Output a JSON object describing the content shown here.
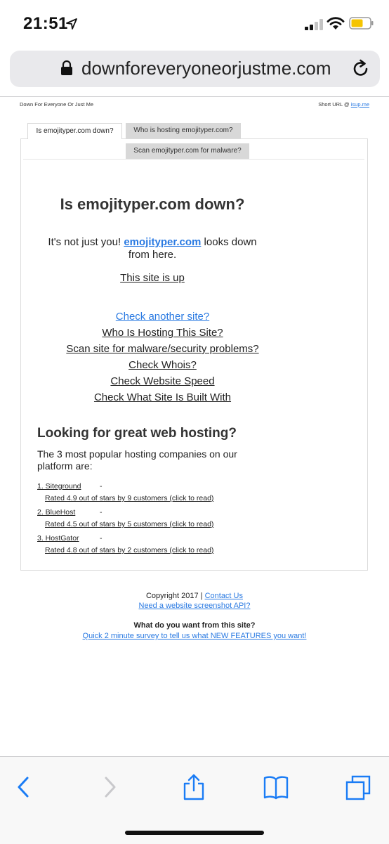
{
  "status_bar": {
    "time": "21:51"
  },
  "browser": {
    "url": "downforeveryoneorjustme.com"
  },
  "page": {
    "site_name": "Down For Everyone Or Just Me",
    "short_url_label": "Short URL @",
    "short_url_link": "isup.me",
    "tabs": [
      {
        "label": "Is emojityper.com down?"
      },
      {
        "label": "Who is hosting emojityper.com?"
      },
      {
        "label": "Scan emojityper.com for malware?"
      }
    ],
    "headline": "Is emojityper.com down?",
    "status_pre": "It's not just you!",
    "status_domain": "emojityper.com",
    "status_post": "looks down from here.",
    "up_link": "This site is up",
    "links": [
      {
        "label": "Check another site?"
      },
      {
        "label": "Who Is Hosting This Site?"
      },
      {
        "label": "Scan site for malware/security problems?"
      },
      {
        "label": "Check Whois?"
      },
      {
        "label": "Check Website Speed"
      },
      {
        "label": "Check What Site Is Built With"
      }
    ],
    "hosting_title": "Looking for great web hosting?",
    "hosting_sub": "The 3 most popular hosting companies on our platform are:",
    "hosts": [
      {
        "name": "1. Siteground",
        "dash": "-",
        "rating": "Rated 4.9 out of stars by 9 customers (click to read)"
      },
      {
        "name": "2. BlueHost",
        "dash": "-",
        "rating": "Rated 4.5 out of stars by 5 customers (click to read)"
      },
      {
        "name": "3. HostGator",
        "dash": "-",
        "rating": "Rated 4.8 out of stars by 2 customers (click to read)"
      }
    ]
  },
  "footer": {
    "copyright": "Copyright 2017 |",
    "contact": "Contact Us",
    "api_link": "Need a website screenshot API?",
    "question": "What do you want from this site?",
    "survey": "Quick 2 minute survey to tell us what NEW FEATURES you want!"
  },
  "toolbar": {
    "icons": [
      "back-icon",
      "forward-icon",
      "share-icon",
      "bookmarks-icon",
      "tabs-icon"
    ]
  },
  "colors": {
    "link": "#2a7ae2",
    "ios_blue": "#1a7cf5",
    "battery": "#f5c400"
  }
}
